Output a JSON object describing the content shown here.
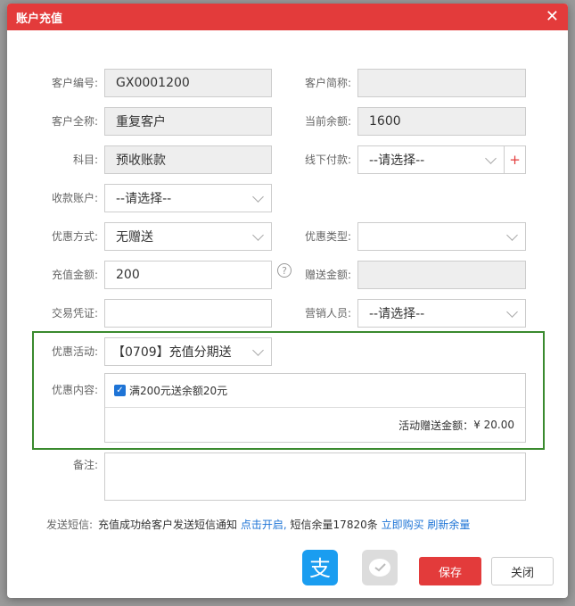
{
  "dialog": {
    "title": "账户充值",
    "close_glyph": "✕"
  },
  "form": {
    "customer_no": {
      "label": "客户编号:",
      "value": "GX0001200"
    },
    "customer_short": {
      "label": "客户简称:",
      "value": ""
    },
    "customer_full": {
      "label": "客户全称:",
      "value": "重复客户"
    },
    "balance": {
      "label": "当前余额:",
      "value": "1600"
    },
    "subject": {
      "label": "科目:",
      "value": "预收账款"
    },
    "offline_pay": {
      "label": "线下付款:",
      "value": "--请选择--",
      "plus": "+"
    },
    "receive_account": {
      "label": "收款账户:",
      "value": "--请选择--"
    },
    "promo_method": {
      "label": "优惠方式:",
      "value": "无赠送"
    },
    "promo_type": {
      "label": "优惠类型:",
      "value": ""
    },
    "recharge_amount": {
      "label": "充值金额:",
      "value": "200",
      "help": "?"
    },
    "gift_amount": {
      "label": "赠送金额:",
      "value": ""
    },
    "voucher": {
      "label": "交易凭证:",
      "value": ""
    },
    "sales": {
      "label": "营销人员:",
      "value": "--请选择--"
    },
    "promo_activity": {
      "label": "优惠活动:",
      "value": "【0709】充值分期送"
    },
    "promo_content": {
      "label": "优惠内容:",
      "item": "满200元送余额20元",
      "checked": true,
      "total_label": "活动赠送金额：",
      "total_value": "¥ 20.00"
    },
    "remark": {
      "label": "备注:",
      "value": ""
    }
  },
  "sms": {
    "label": "发送短信:",
    "text": "充值成功给客户发送短信通知",
    "enable_link": "点击开启,",
    "remain": "短信余量17820条",
    "buy_link": "立即购买",
    "refresh_link": "刷新余量"
  },
  "actions": {
    "save": "保存",
    "close": "关闭"
  },
  "colors": {
    "accent": "#e33b3b",
    "link": "#1e74d6",
    "highlight_border": "#3a8a2e",
    "alipay": "#1a9df0"
  }
}
